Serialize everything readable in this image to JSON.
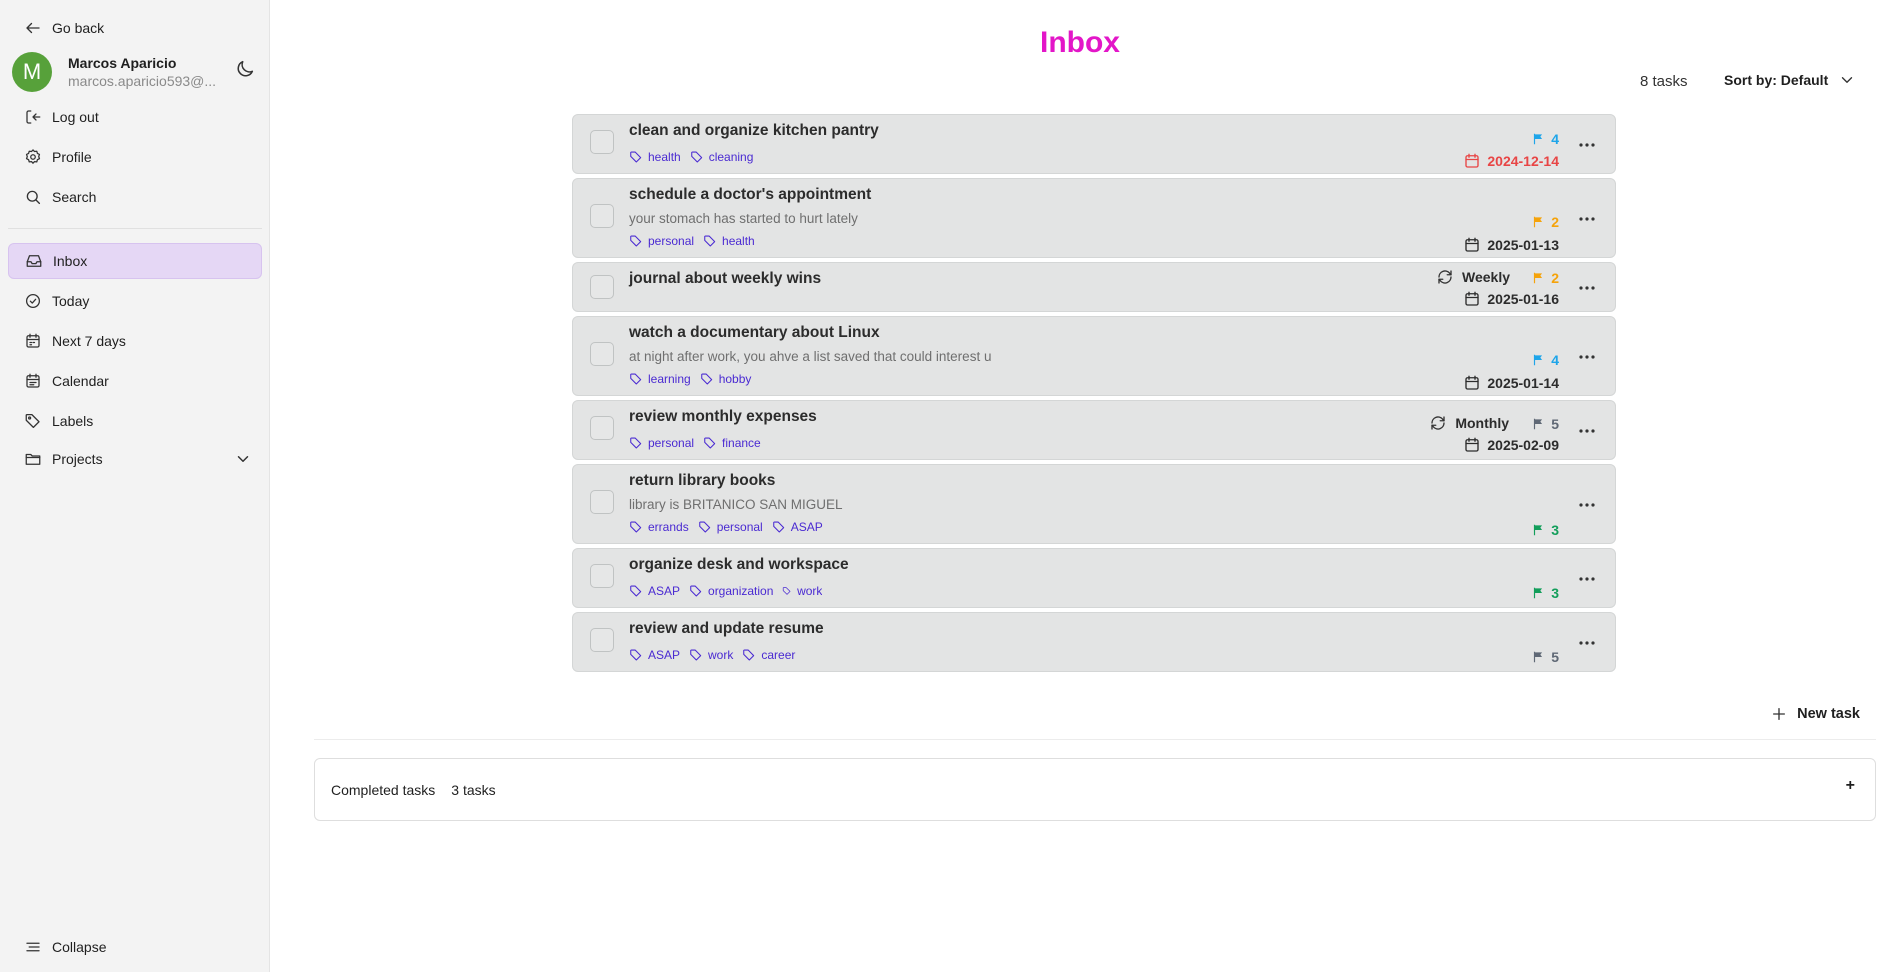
{
  "sidebar": {
    "go_back": "Go back",
    "user": {
      "initial": "M",
      "name": "Marcos Aparicio",
      "email": "marcos.aparicio593@..."
    },
    "top_links": [
      {
        "label": "Log out"
      },
      {
        "label": "Profile"
      },
      {
        "label": "Search"
      }
    ],
    "nav": [
      {
        "label": "Inbox",
        "icon": "inbox-icon",
        "active": true
      },
      {
        "label": "Today",
        "icon": "check-circle-icon"
      },
      {
        "label": "Next 7 days",
        "icon": "calendar-week-icon"
      },
      {
        "label": "Calendar",
        "icon": "calendar-icon"
      },
      {
        "label": "Labels",
        "icon": "tag-icon"
      },
      {
        "label": "Projects",
        "icon": "folder-icon"
      }
    ],
    "collapse": "Collapse"
  },
  "main": {
    "title": "Inbox",
    "task_count": "8 tasks",
    "sort_label": "Sort by: Default",
    "new_task": "New task",
    "completed": {
      "label": "Completed tasks",
      "count": "3 tasks",
      "toggle": "+"
    }
  },
  "tasks": [
    {
      "title": "clean and organize kitchen pantry",
      "labels": [
        "health",
        "cleaning"
      ],
      "priority": "4",
      "due": "2024-12-14",
      "overdue": true
    },
    {
      "title": "schedule a doctor's appointment",
      "description": "your stomach has started to hurt lately",
      "labels": [
        "personal",
        "health"
      ],
      "priority": "2",
      "due": "2025-01-13"
    },
    {
      "title": "journal about weekly wins",
      "recurrence": "Weekly",
      "priority": "2",
      "due": "2025-01-16"
    },
    {
      "title": "watch a documentary about Linux",
      "description": "at night after work, you ahve a list saved that could interest u",
      "labels": [
        "learning",
        "hobby"
      ],
      "priority": "4",
      "due": "2025-01-14"
    },
    {
      "title": "review monthly expenses",
      "labels": [
        "personal",
        "finance"
      ],
      "recurrence": "Monthly",
      "priority": "5",
      "due": "2025-02-09"
    },
    {
      "title": "return library books",
      "description": "library is BRITANICO SAN MIGUEL",
      "labels": [
        "errands",
        "personal",
        "ASAP"
      ],
      "priority": "3"
    },
    {
      "title": "organize desk and workspace",
      "labels": [
        "ASAP",
        "organization",
        "work"
      ],
      "priority": "3"
    },
    {
      "title": "review and update resume",
      "labels": [
        "ASAP",
        "work",
        "career"
      ],
      "priority": "5"
    }
  ],
  "colors": {
    "accent": "#e316c8",
    "priority_4": "#1ea5e9",
    "priority_2": "#f5a30b",
    "priority_3": "#129e5a",
    "priority_5": "#5f6875",
    "overdue": "#e84545",
    "label": "#4a2ad2",
    "active_nav": "#e5d7f5"
  }
}
